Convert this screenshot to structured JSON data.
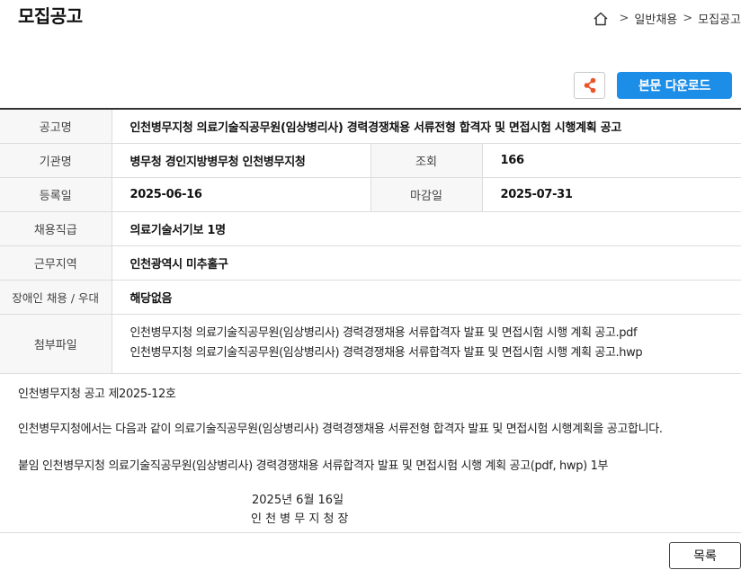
{
  "header": {
    "title": "모집공고",
    "breadcrumb": [
      "일반채용",
      "모집공고"
    ]
  },
  "actions": {
    "download_label": "본문 다운로드",
    "list_label": "목록"
  },
  "info": {
    "title_label": "공고명",
    "title_value": "인천병무지청 의료기술직공무원(임상병리사) 경력경쟁채용 서류전형 합격자 및 면접시험 시행계획 공고",
    "org_label": "기관명",
    "org_value": "병무청 경인지방병무청 인천병무지청",
    "views_label": "조회",
    "views_value": "166",
    "reg_label": "등록일",
    "reg_value": "2025-06-16",
    "deadline_label": "마감일",
    "deadline_value": "2025-07-31",
    "grade_label": "채용직급",
    "grade_value": "의료기술서기보 1명",
    "region_label": "근무지역",
    "region_value": "인천광역시 미추홀구",
    "disabled_label": "장애인 채용 / 우대",
    "disabled_value": "해당없음",
    "attach_label": "첨부파일",
    "attachments": [
      "인천병무지청 의료기술직공무원(임상병리사) 경력경쟁채용 서류합격자 발표 및 면접시험 시행 계획 공고.pdf",
      "인천병무지청 의료기술직공무원(임상병리사) 경력경쟁채용 서류합격자 발표 및 면접시험 시행 계획 공고.hwp"
    ]
  },
  "content": {
    "notice_no": "인천병무지청 공고 제2025-12호",
    "paragraph": "인천병무지청에서는 다음과 같이 의료기술직공무원(임상병리사) 경력경쟁채용 서류전형 합격자 발표 및 면접시험 시행계획을 공고합니다.",
    "attachment_note": "붙임  인천병무지청 의료기술직공무원(임상병리사) 경력경쟁채용 서류합격자 발표 및 면접시험 시행 계획 공고(pdf, hwp) 1부",
    "date": "2025년 6월 16일",
    "signature": "인 천 병 무 지 청 장"
  },
  "colors": {
    "accent": "#1d8ee8",
    "share_icon": "#e8552a"
  },
  "icons": [
    "home-icon",
    "share-icon"
  ]
}
